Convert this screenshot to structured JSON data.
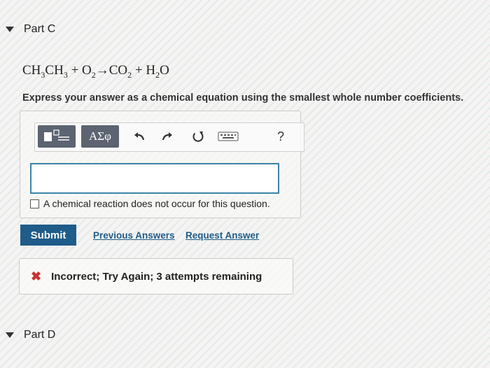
{
  "part_c": {
    "label": "Part C"
  },
  "equation": {
    "t1": "CH",
    "s1": "3",
    "t2": "CH",
    "s2": "3",
    "t3": " + O",
    "s3": "2",
    "t4": "→CO",
    "s4": "2",
    "t5": " + H",
    "s5": "2",
    "t6": "O"
  },
  "instruction": "Express your answer as a chemical equation using the smallest whole number coefficients.",
  "toolbar": {
    "templates_icon": "templates-icon",
    "greek_label": "ΑΣφ",
    "undo_icon": "undo-icon",
    "redo_icon": "redo-icon",
    "reset_icon": "reset-icon",
    "keyboard_icon": "keyboard-icon",
    "help_label": "?"
  },
  "answer": {
    "value": ""
  },
  "no_reaction_label": "A chemical reaction does not occur for this question.",
  "actions": {
    "submit_label": "Submit",
    "previous_answers_label": "Previous Answers",
    "request_answer_label": "Request Answer"
  },
  "feedback": {
    "icon": "x-icon",
    "text": "Incorrect; Try Again; 3 attempts remaining"
  },
  "part_d": {
    "label": "Part D"
  },
  "colors": {
    "accent": "#1f5c89",
    "input_border": "#3b84a8",
    "error": "#c83232"
  }
}
